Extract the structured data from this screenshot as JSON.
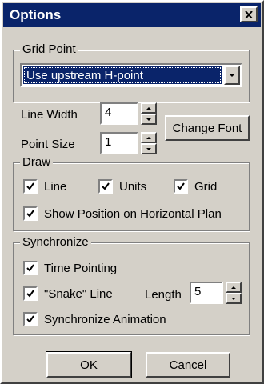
{
  "window": {
    "title": "Options"
  },
  "grid_point": {
    "legend": "Grid Point",
    "selected": "Use upstream H-point"
  },
  "line_width": {
    "label": "Line Width",
    "value": "4"
  },
  "point_size": {
    "label": "Point Size",
    "value": "1"
  },
  "change_font": "Change Font",
  "draw": {
    "legend": "Draw",
    "line": "Line",
    "units": "Units",
    "grid": "Grid",
    "show_position": "Show Position on Horizontal Plan"
  },
  "synchronize": {
    "legend": "Synchronize",
    "time_pointing": "Time Pointing",
    "snake_line": "\"Snake\" Line",
    "length_label": "Length",
    "length_value": "5",
    "sync_animation": "Synchronize Animation"
  },
  "buttons": {
    "ok": "OK",
    "cancel": "Cancel"
  }
}
